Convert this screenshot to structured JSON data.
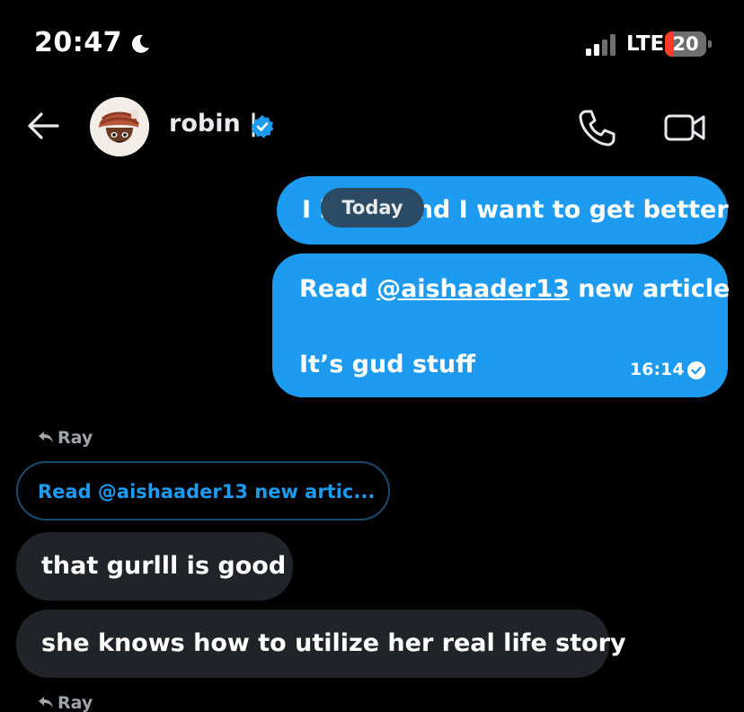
{
  "status_bar": {
    "time": "20:47",
    "network": "LTE",
    "battery": "20",
    "battery_level": 0.2,
    "battery_color": "#ff3b30",
    "moon_icon": "moon-icon"
  },
  "header": {
    "contact_name": "robin |",
    "verified_color": "#1d9bf0",
    "icons": [
      "back-arrow-icon",
      "verified-badge-icon",
      "phone-icon",
      "video-camera-icon"
    ]
  },
  "date_divider": "Today",
  "messages_out": [
    {
      "text_before": "I l",
      "text_after": "nd I want to get better"
    },
    {
      "line1_prefix": "Read ",
      "line1_mention": "@aishaader13",
      "line1_suffix": " new article",
      "line2": "It’s gud stuff",
      "time": "16:14"
    }
  ],
  "reply_context": {
    "label_1": "Ray",
    "quoted_text": "Read @aishaader13 new artic...",
    "label_2": "Ray"
  },
  "messages_in": [
    {
      "text": "that gurlll is good"
    },
    {
      "text": "she knows how to utilize her real life story"
    }
  ],
  "colors": {
    "accent": "#1d9bf0",
    "background": "#000000",
    "incoming_bubble": "#202327",
    "date_pill": "#2b4a63"
  }
}
